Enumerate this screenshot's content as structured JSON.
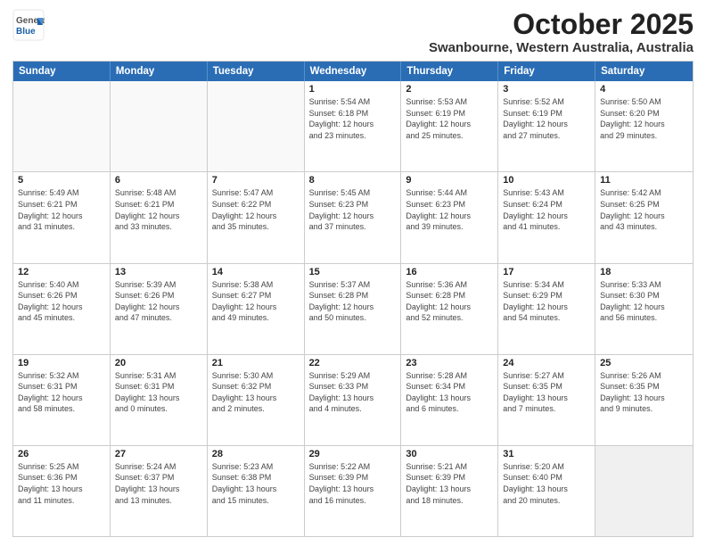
{
  "logo": {
    "general": "General",
    "blue": "Blue"
  },
  "title": "October 2025",
  "subtitle": "Swanbourne, Western Australia, Australia",
  "days": [
    "Sunday",
    "Monday",
    "Tuesday",
    "Wednesday",
    "Thursday",
    "Friday",
    "Saturday"
  ],
  "weeks": [
    [
      {
        "num": "",
        "info": ""
      },
      {
        "num": "",
        "info": ""
      },
      {
        "num": "",
        "info": ""
      },
      {
        "num": "1",
        "info": "Sunrise: 5:54 AM\nSunset: 6:18 PM\nDaylight: 12 hours\nand 23 minutes."
      },
      {
        "num": "2",
        "info": "Sunrise: 5:53 AM\nSunset: 6:19 PM\nDaylight: 12 hours\nand 25 minutes."
      },
      {
        "num": "3",
        "info": "Sunrise: 5:52 AM\nSunset: 6:19 PM\nDaylight: 12 hours\nand 27 minutes."
      },
      {
        "num": "4",
        "info": "Sunrise: 5:50 AM\nSunset: 6:20 PM\nDaylight: 12 hours\nand 29 minutes."
      }
    ],
    [
      {
        "num": "5",
        "info": "Sunrise: 5:49 AM\nSunset: 6:21 PM\nDaylight: 12 hours\nand 31 minutes."
      },
      {
        "num": "6",
        "info": "Sunrise: 5:48 AM\nSunset: 6:21 PM\nDaylight: 12 hours\nand 33 minutes."
      },
      {
        "num": "7",
        "info": "Sunrise: 5:47 AM\nSunset: 6:22 PM\nDaylight: 12 hours\nand 35 minutes."
      },
      {
        "num": "8",
        "info": "Sunrise: 5:45 AM\nSunset: 6:23 PM\nDaylight: 12 hours\nand 37 minutes."
      },
      {
        "num": "9",
        "info": "Sunrise: 5:44 AM\nSunset: 6:23 PM\nDaylight: 12 hours\nand 39 minutes."
      },
      {
        "num": "10",
        "info": "Sunrise: 5:43 AM\nSunset: 6:24 PM\nDaylight: 12 hours\nand 41 minutes."
      },
      {
        "num": "11",
        "info": "Sunrise: 5:42 AM\nSunset: 6:25 PM\nDaylight: 12 hours\nand 43 minutes."
      }
    ],
    [
      {
        "num": "12",
        "info": "Sunrise: 5:40 AM\nSunset: 6:26 PM\nDaylight: 12 hours\nand 45 minutes."
      },
      {
        "num": "13",
        "info": "Sunrise: 5:39 AM\nSunset: 6:26 PM\nDaylight: 12 hours\nand 47 minutes."
      },
      {
        "num": "14",
        "info": "Sunrise: 5:38 AM\nSunset: 6:27 PM\nDaylight: 12 hours\nand 49 minutes."
      },
      {
        "num": "15",
        "info": "Sunrise: 5:37 AM\nSunset: 6:28 PM\nDaylight: 12 hours\nand 50 minutes."
      },
      {
        "num": "16",
        "info": "Sunrise: 5:36 AM\nSunset: 6:28 PM\nDaylight: 12 hours\nand 52 minutes."
      },
      {
        "num": "17",
        "info": "Sunrise: 5:34 AM\nSunset: 6:29 PM\nDaylight: 12 hours\nand 54 minutes."
      },
      {
        "num": "18",
        "info": "Sunrise: 5:33 AM\nSunset: 6:30 PM\nDaylight: 12 hours\nand 56 minutes."
      }
    ],
    [
      {
        "num": "19",
        "info": "Sunrise: 5:32 AM\nSunset: 6:31 PM\nDaylight: 12 hours\nand 58 minutes."
      },
      {
        "num": "20",
        "info": "Sunrise: 5:31 AM\nSunset: 6:31 PM\nDaylight: 13 hours\nand 0 minutes."
      },
      {
        "num": "21",
        "info": "Sunrise: 5:30 AM\nSunset: 6:32 PM\nDaylight: 13 hours\nand 2 minutes."
      },
      {
        "num": "22",
        "info": "Sunrise: 5:29 AM\nSunset: 6:33 PM\nDaylight: 13 hours\nand 4 minutes."
      },
      {
        "num": "23",
        "info": "Sunrise: 5:28 AM\nSunset: 6:34 PM\nDaylight: 13 hours\nand 6 minutes."
      },
      {
        "num": "24",
        "info": "Sunrise: 5:27 AM\nSunset: 6:35 PM\nDaylight: 13 hours\nand 7 minutes."
      },
      {
        "num": "25",
        "info": "Sunrise: 5:26 AM\nSunset: 6:35 PM\nDaylight: 13 hours\nand 9 minutes."
      }
    ],
    [
      {
        "num": "26",
        "info": "Sunrise: 5:25 AM\nSunset: 6:36 PM\nDaylight: 13 hours\nand 11 minutes."
      },
      {
        "num": "27",
        "info": "Sunrise: 5:24 AM\nSunset: 6:37 PM\nDaylight: 13 hours\nand 13 minutes."
      },
      {
        "num": "28",
        "info": "Sunrise: 5:23 AM\nSunset: 6:38 PM\nDaylight: 13 hours\nand 15 minutes."
      },
      {
        "num": "29",
        "info": "Sunrise: 5:22 AM\nSunset: 6:39 PM\nDaylight: 13 hours\nand 16 minutes."
      },
      {
        "num": "30",
        "info": "Sunrise: 5:21 AM\nSunset: 6:39 PM\nDaylight: 13 hours\nand 18 minutes."
      },
      {
        "num": "31",
        "info": "Sunrise: 5:20 AM\nSunset: 6:40 PM\nDaylight: 13 hours\nand 20 minutes."
      },
      {
        "num": "",
        "info": ""
      }
    ]
  ]
}
